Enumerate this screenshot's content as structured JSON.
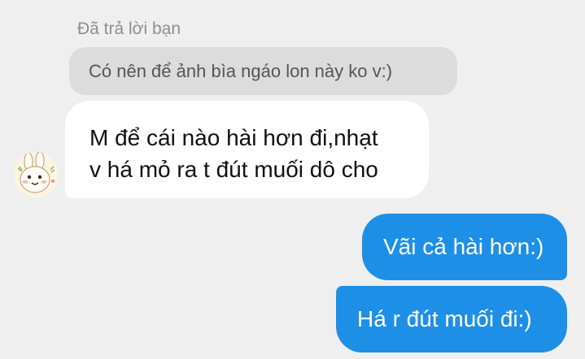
{
  "reply_label": "Đã trả lời bạn",
  "quoted_message": "Có nên để ảnh bìa ngáo lon này ko v:)",
  "received_message": {
    "lines": [
      "M để cái nào hài hơn đi,nhạt",
      "v há mỏ ra t đút muối dô cho"
    ]
  },
  "sent_messages": [
    "Vãi cả hài hơn:)",
    "Há r đút muối đi:)"
  ],
  "avatar": {
    "icon": "bunny-sticker-avatar"
  },
  "colors": {
    "background": "#efefef",
    "quoted_bubble": "#dcdcdc",
    "received_bubble": "#ffffff",
    "sent_bubble": "#1e8fe6"
  }
}
